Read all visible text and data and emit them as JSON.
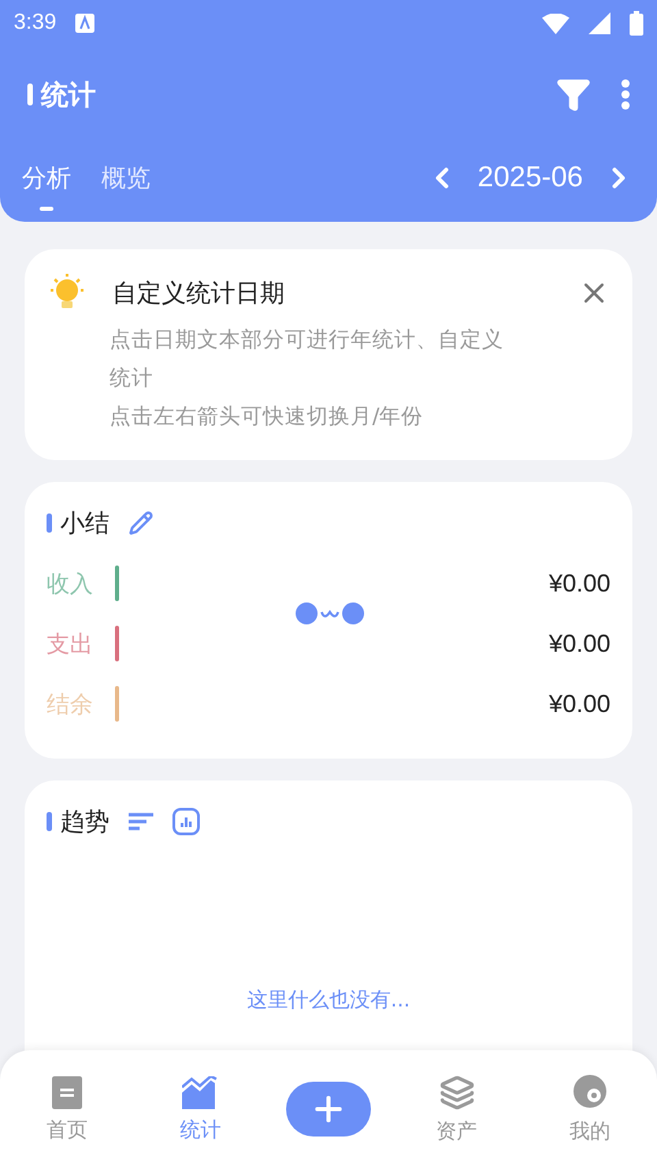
{
  "status_bar": {
    "time": "3:39"
  },
  "app_bar": {
    "title": "统计"
  },
  "tabs": [
    {
      "label": "分析",
      "selected": true
    },
    {
      "label": "概览",
      "selected": false
    }
  ],
  "period": {
    "value": "2025-06"
  },
  "tip_card": {
    "title": "自定义统计日期",
    "lines": [
      "点击日期文本部分可进行年统计、自定义统计",
      "点击左右箭头可快速切换月/年份"
    ]
  },
  "summary": {
    "title": "小结",
    "rows": [
      {
        "label": "收入",
        "amount": "¥0.00",
        "color": "#5fae8c"
      },
      {
        "label": "支出",
        "amount": "¥0.00",
        "color": "#d9707e"
      },
      {
        "label": "结余",
        "amount": "¥0.00",
        "color": "#e8b88a"
      }
    ]
  },
  "trend": {
    "title": "趋势",
    "empty_text": "这里什么也没有..."
  },
  "bottom_nav": [
    {
      "kind": "home",
      "label": "首页",
      "selected": false
    },
    {
      "kind": "stats",
      "label": "统计",
      "selected": true
    },
    {
      "kind": "add",
      "selected": false
    },
    {
      "kind": "assets",
      "label": "资产",
      "selected": false
    },
    {
      "kind": "me",
      "label": "我的",
      "selected": false
    }
  ]
}
